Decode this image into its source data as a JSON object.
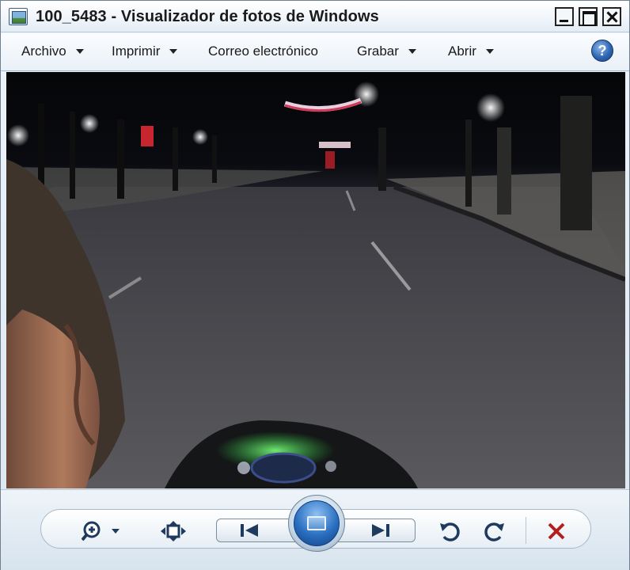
{
  "window": {
    "title": "100_5483 - Visualizador de fotos de Windows"
  },
  "menu": {
    "items": [
      {
        "label": "Archivo",
        "has_dropdown": true
      },
      {
        "label": "Imprimir",
        "has_dropdown": true
      },
      {
        "label": "Correo electrónico",
        "has_dropdown": false
      },
      {
        "label": "Grabar",
        "has_dropdown": true
      },
      {
        "label": "Abrir",
        "has_dropdown": true
      }
    ],
    "help": "?"
  },
  "toolbar": {
    "buttons": [
      {
        "name": "zoom",
        "icon": "magnifier-plus-icon"
      },
      {
        "name": "actual-size",
        "icon": "fit-to-window-icon"
      },
      {
        "name": "previous",
        "icon": "skip-previous-icon"
      },
      {
        "name": "slideshow",
        "icon": "slideshow-icon"
      },
      {
        "name": "next",
        "icon": "skip-next-icon"
      },
      {
        "name": "rotate-counterclockwise",
        "icon": "rotate-ccw-icon"
      },
      {
        "name": "rotate-clockwise",
        "icon": "rotate-cw-icon"
      },
      {
        "name": "delete",
        "icon": "delete-x-icon"
      }
    ]
  },
  "colors": {
    "title_text": "#1b1b1b",
    "delete_red": "#b02020",
    "slideshow_blue": "#2a6fc0",
    "photo_dark": "#0a0b10",
    "road_gray": "#55565a"
  }
}
